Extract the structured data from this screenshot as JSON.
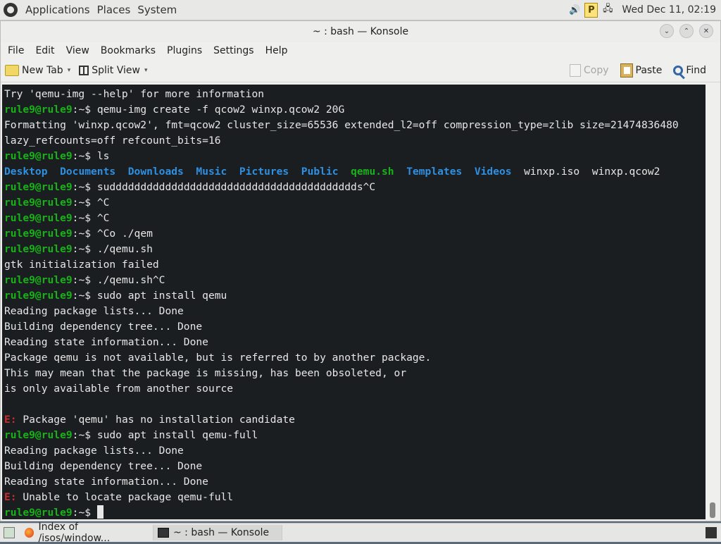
{
  "top_panel": {
    "menus": [
      "Applications",
      "Places",
      "System"
    ],
    "clock": "Wed Dec 11, 02:19"
  },
  "window": {
    "title": "~ : bash — Konsole"
  },
  "menubar": [
    "File",
    "Edit",
    "View",
    "Bookmarks",
    "Plugins",
    "Settings",
    "Help"
  ],
  "toolbar": {
    "new_tab": "New Tab",
    "split_view": "Split View",
    "copy": "Copy",
    "paste": "Paste",
    "find": "Find"
  },
  "terminal": {
    "prompt": "rule9@rule9",
    "lines": [
      {
        "type": "out",
        "text": "Try 'qemu-img --help' for more information"
      },
      {
        "type": "cmd",
        "text": "qemu-img create -f qcow2 winxp.qcow2 20G"
      },
      {
        "type": "out",
        "text": "Formatting 'winxp.qcow2', fmt=qcow2 cluster_size=65536 extended_l2=off compression_type=zlib size=21474836480"
      },
      {
        "type": "out",
        "text": "lazy_refcounts=off refcount_bits=16"
      },
      {
        "type": "cmd",
        "text": "ls"
      },
      {
        "type": "ls",
        "items": [
          {
            "name": "Desktop",
            "kind": "dir"
          },
          {
            "name": "Documents",
            "kind": "dir"
          },
          {
            "name": "Downloads",
            "kind": "dir"
          },
          {
            "name": "Music",
            "kind": "dir"
          },
          {
            "name": "Pictures",
            "kind": "dir"
          },
          {
            "name": "Public",
            "kind": "dir"
          },
          {
            "name": "qemu.sh",
            "kind": "exe"
          },
          {
            "name": "Templates",
            "kind": "dir"
          },
          {
            "name": "Videos",
            "kind": "dir"
          },
          {
            "name": "winxp.iso",
            "kind": "file"
          },
          {
            "name": "winxp.qcow2",
            "kind": "file"
          }
        ]
      },
      {
        "type": "cmd",
        "text": "sudddddddddddddddddddddddddddddddddddddddds^C"
      },
      {
        "type": "cmd",
        "text": "^C"
      },
      {
        "type": "cmd",
        "text": "^C"
      },
      {
        "type": "cmd",
        "text": "^Co ./qem"
      },
      {
        "type": "cmd",
        "text": "./qemu.sh"
      },
      {
        "type": "out",
        "text": "gtk initialization failed"
      },
      {
        "type": "cmd",
        "text": "./qemu.sh^C"
      },
      {
        "type": "cmd",
        "text": "sudo apt install qemu"
      },
      {
        "type": "out",
        "text": "Reading package lists... Done"
      },
      {
        "type": "out",
        "text": "Building dependency tree... Done"
      },
      {
        "type": "out",
        "text": "Reading state information... Done"
      },
      {
        "type": "out",
        "text": "Package qemu is not available, but is referred to by another package."
      },
      {
        "type": "out",
        "text": "This may mean that the package is missing, has been obsoleted, or"
      },
      {
        "type": "out",
        "text": "is only available from another source"
      },
      {
        "type": "out",
        "text": ""
      },
      {
        "type": "err",
        "label": "E:",
        "text": " Package 'qemu' has no installation candidate"
      },
      {
        "type": "cmd",
        "text": "sudo apt install qemu-full"
      },
      {
        "type": "out",
        "text": "Reading package lists... Done"
      },
      {
        "type": "out",
        "text": "Building dependency tree... Done"
      },
      {
        "type": "out",
        "text": "Reading state information... Done"
      },
      {
        "type": "err",
        "label": "E:",
        "text": " Unable to locate package qemu-full"
      },
      {
        "type": "cursor",
        "text": ""
      }
    ]
  },
  "taskbar": {
    "tasks": [
      {
        "label": "Index of /isos/window...",
        "icon": "firefox-icon"
      },
      {
        "label": "~ : bash — Konsole",
        "icon": "konsole-icon"
      }
    ]
  },
  "colors": {
    "prompt": "#18b218",
    "directory": "#2f8fe0",
    "error": "#cb2c2c",
    "terminal_bg": "#1b1e21"
  }
}
